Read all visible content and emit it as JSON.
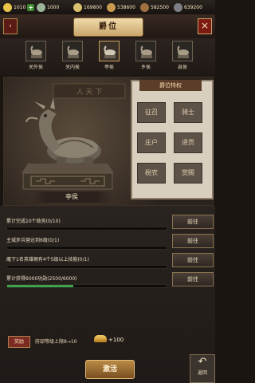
{
  "resources": [
    {
      "value": "1010",
      "icon": "yellow-coin-icon",
      "color": "#e8c44a"
    },
    {
      "value": "1000",
      "icon": "silver-coin-icon",
      "color": "#9ab59a"
    },
    {
      "value": "169800",
      "icon": "grain-icon",
      "color": "#d9c170"
    },
    {
      "value": "538600",
      "icon": "ingot-icon",
      "color": "#c79a4d"
    },
    {
      "value": "582500",
      "icon": "wood-icon",
      "color": "#a07040"
    },
    {
      "value": "639200",
      "icon": "iron-icon",
      "color": "#7c7f86"
    }
  ],
  "header": {
    "title": "爵位",
    "back": "返回",
    "close": "×"
  },
  "tabs": [
    {
      "label": "关外侯",
      "selected": false
    },
    {
      "label": "关内侯",
      "selected": false
    },
    {
      "label": "亭侯",
      "selected": true
    },
    {
      "label": "乡侯",
      "selected": false
    },
    {
      "label": "县侯",
      "selected": false
    }
  ],
  "display": {
    "rank_name": "亭侯",
    "wall_text": "人 天 下"
  },
  "privileges": {
    "title": "爵位特权",
    "items": [
      "征召",
      "骑士",
      "庄户",
      "进贡",
      "税农",
      "赏赐"
    ]
  },
  "tasks": [
    {
      "text": "累计完成10个政务(0/10)",
      "progress": 0,
      "button": "前往"
    },
    {
      "text": "主城步兵营达到6级(0/1)",
      "progress": 0,
      "button": "前往"
    },
    {
      "text": "麾下1名英雄拥有4个5级以上技能(0/1)",
      "progress": 0,
      "button": "前往"
    },
    {
      "text": "累计获得6000功勋(2500/6000)",
      "progress": 0.4167,
      "button": "前往"
    }
  ],
  "reward": {
    "tag": "奖励",
    "text": "府邸等级上限8→10",
    "gold": "+100"
  },
  "bottom": {
    "activate": "激活",
    "return": "返回"
  }
}
